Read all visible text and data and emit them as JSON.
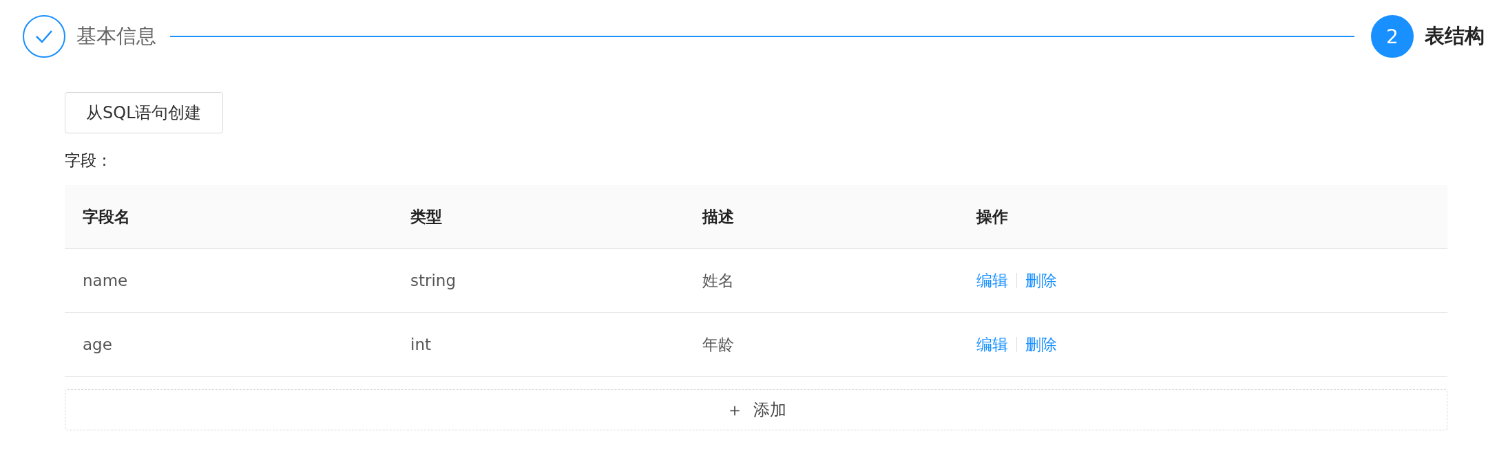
{
  "steps": [
    {
      "title": "基本信息",
      "completed": true,
      "current": false
    },
    {
      "index": "2",
      "title": "表结构",
      "completed": false,
      "current": true
    }
  ],
  "sql_button": "从SQL语句创建",
  "fields_label": "字段：",
  "table": {
    "columns": [
      "字段名",
      "类型",
      "描述",
      "操作"
    ],
    "rows": [
      {
        "name": "name",
        "type": "string",
        "description": "姓名",
        "actions": [
          "编辑",
          "删除"
        ]
      },
      {
        "name": "age",
        "type": "int",
        "description": "年龄",
        "actions": [
          "编辑",
          "删除"
        ]
      }
    ]
  },
  "add_button": {
    "icon": "＋",
    "label": "添加"
  }
}
